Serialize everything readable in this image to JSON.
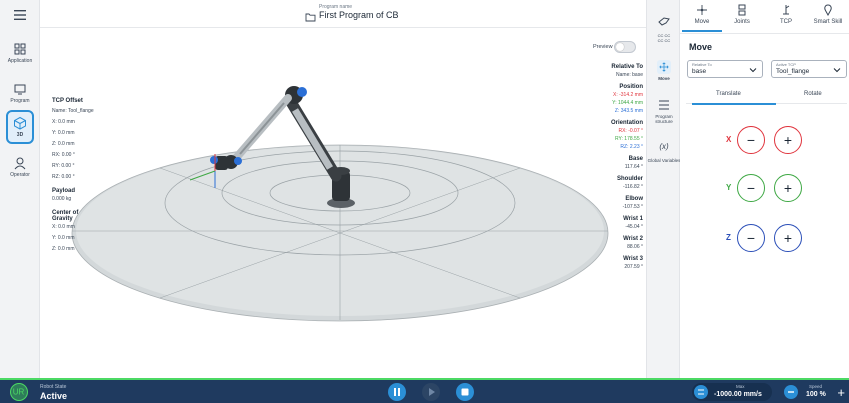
{
  "left_nav": {
    "items": [
      {
        "label": "Application",
        "icon": "grid-icon"
      },
      {
        "label": "Program",
        "icon": "monitor-icon"
      },
      {
        "label": "3D",
        "icon": "cube-icon"
      },
      {
        "label": "Operator",
        "icon": "person-icon"
      }
    ]
  },
  "header": {
    "program_caption": "Program name",
    "program_name": "First Program of CB"
  },
  "viewport": {
    "preview_label": "Preview",
    "tcp_offset": {
      "title": "TCP Offset",
      "name": "Name: Tool_flange",
      "x": "X: 0.0 mm",
      "y": "Y: 0.0 mm",
      "z": "Z: 0.0 mm",
      "rx": "RX: 0.00 °",
      "ry": "RY: 0.00 °",
      "rz": "RZ: 0.00 °"
    },
    "payload": {
      "title": "Payload",
      "value": "0.000 kg"
    },
    "cog": {
      "title": "Center of Gravity",
      "x": "X: 0.0 mm",
      "y": "Y: 0.0 mm",
      "z": "Z: 0.0 mm"
    },
    "relative_to": {
      "title": "Relative To",
      "value": "Name: base"
    },
    "position": {
      "title": "Position",
      "x": "X: -314.2 mm",
      "y": "Y: 1044.4 mm",
      "z": "Z: 343.5 mm"
    },
    "orientation": {
      "title": "Orientation",
      "rx": "RX: -0.07 °",
      "ry": "RY: 178.55 °",
      "rz": "RZ: 2.23 °"
    },
    "joints": [
      {
        "name": "Base",
        "value": "117.64 °"
      },
      {
        "name": "Shoulder",
        "value": "-116.82 °"
      },
      {
        "name": "Elbow",
        "value": "-107.53 °"
      },
      {
        "name": "Wrist 1",
        "value": "-45.04 °"
      },
      {
        "name": "Wrist 2",
        "value": "88.06 °"
      },
      {
        "name": "Wrist 3",
        "value": "207.59 °"
      }
    ]
  },
  "mid_strip": {
    "items": [
      {
        "label": "",
        "icon": "hand-icon"
      },
      {
        "label": "CC CC\nCC CC",
        "icon": "cc-icon"
      },
      {
        "label": "Move",
        "icon": "move-icon"
      },
      {
        "label": "Program structure",
        "icon": "list-icon"
      },
      {
        "label": "Global Variables",
        "icon": "variable-icon"
      }
    ]
  },
  "right_panel": {
    "tabs": [
      {
        "label": "Move",
        "icon": "move-arrows-icon"
      },
      {
        "label": "Joints",
        "icon": "joints-icon"
      },
      {
        "label": "TCP",
        "icon": "tcp-icon"
      },
      {
        "label": "Smart Skill",
        "icon": "skill-icon"
      }
    ],
    "title": "Move",
    "relative_to": {
      "label": "Relative To",
      "value": "base"
    },
    "active_tcp": {
      "label": "Active TCP",
      "value": "Tool_flange"
    },
    "subtabs": [
      "Translate",
      "Rotate"
    ],
    "axes": [
      {
        "label": "X",
        "color": "#e0343d"
      },
      {
        "label": "Y",
        "color": "#3ea844"
      },
      {
        "label": "Z",
        "color": "#2b4fb8"
      }
    ],
    "minus": "−",
    "plus": "+"
  },
  "bottom_bar": {
    "state_label": "Robot State",
    "state_value": "Active",
    "max_label": "Max",
    "max_value": "-1000.00 mm/s",
    "speed_label": "Speed",
    "speed_value": "100 %",
    "plus": "+"
  }
}
